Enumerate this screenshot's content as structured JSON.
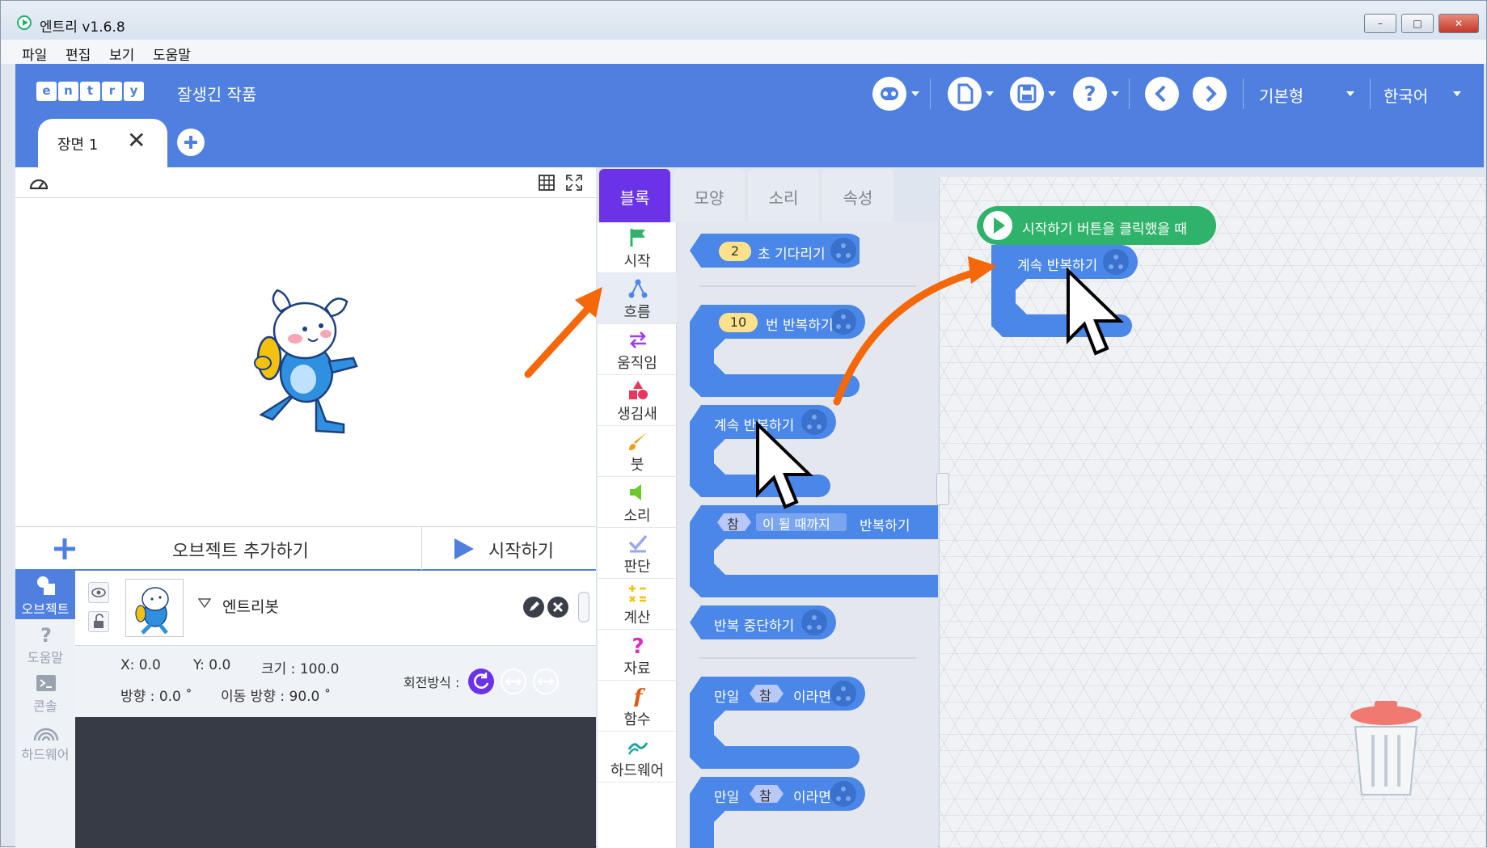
{
  "window": {
    "title": "엔트리 v1.6.8",
    "minimize": "–",
    "maximize": "□",
    "close": "✕"
  },
  "menu": {
    "items": [
      "파일",
      "편집",
      "보기",
      "도움말"
    ]
  },
  "header": {
    "logo_letters": [
      "e",
      "n",
      "t",
      "r",
      "y"
    ],
    "project_name": "잘생긴 작품",
    "mode": "기본형",
    "language": "한국어",
    "scene_tab": "장면 1",
    "close_glyph": "✕"
  },
  "stage": {
    "add_object": "오브젝트 추가하기",
    "start": "시작하기"
  },
  "sidenav": [
    "오브젝트",
    "도움말",
    "콘솔",
    "하드웨어"
  ],
  "object": {
    "name": "엔트리봇",
    "x": "X: 0.0",
    "y": "Y: 0.0",
    "size": "크기 : 100.0",
    "direction": "방향 : 0.0 ˚",
    "move_direction": "이동 방향 : 90.0 ˚",
    "rotation_label": "회전방식 :"
  },
  "tabs": [
    "블록",
    "모양",
    "소리",
    "속성"
  ],
  "categories": [
    "시작",
    "흐름",
    "움직임",
    "생김새",
    "붓",
    "소리",
    "판단",
    "계산",
    "자료",
    "함수",
    "하드웨어"
  ],
  "palette": {
    "wait_value": "2",
    "wait_text": "초 기다리기",
    "repeat_value": "10",
    "repeat_text": "번 반복하기",
    "forever_text": "계속 반복하기",
    "until_cond": "참",
    "until_mid": "이 될 때까지",
    "until_text": "반복하기",
    "break_text": "반복 중단하기",
    "if1_label": "만일",
    "if1_cond": "참",
    "if1_text": "이라면",
    "if2_label": "만일",
    "if2_cond": "참",
    "if2_text": "이라면"
  },
  "workspace": {
    "hat_text": "시작하기 버튼을 클릭했을 때",
    "loop_text": "계속 반복하기"
  },
  "colors": {
    "header": "#4f80e0",
    "tab_active": "#6a33e8",
    "flow_block": "#4b87e8",
    "start_block": "#2fb36b",
    "arrow": "#f5680a"
  }
}
